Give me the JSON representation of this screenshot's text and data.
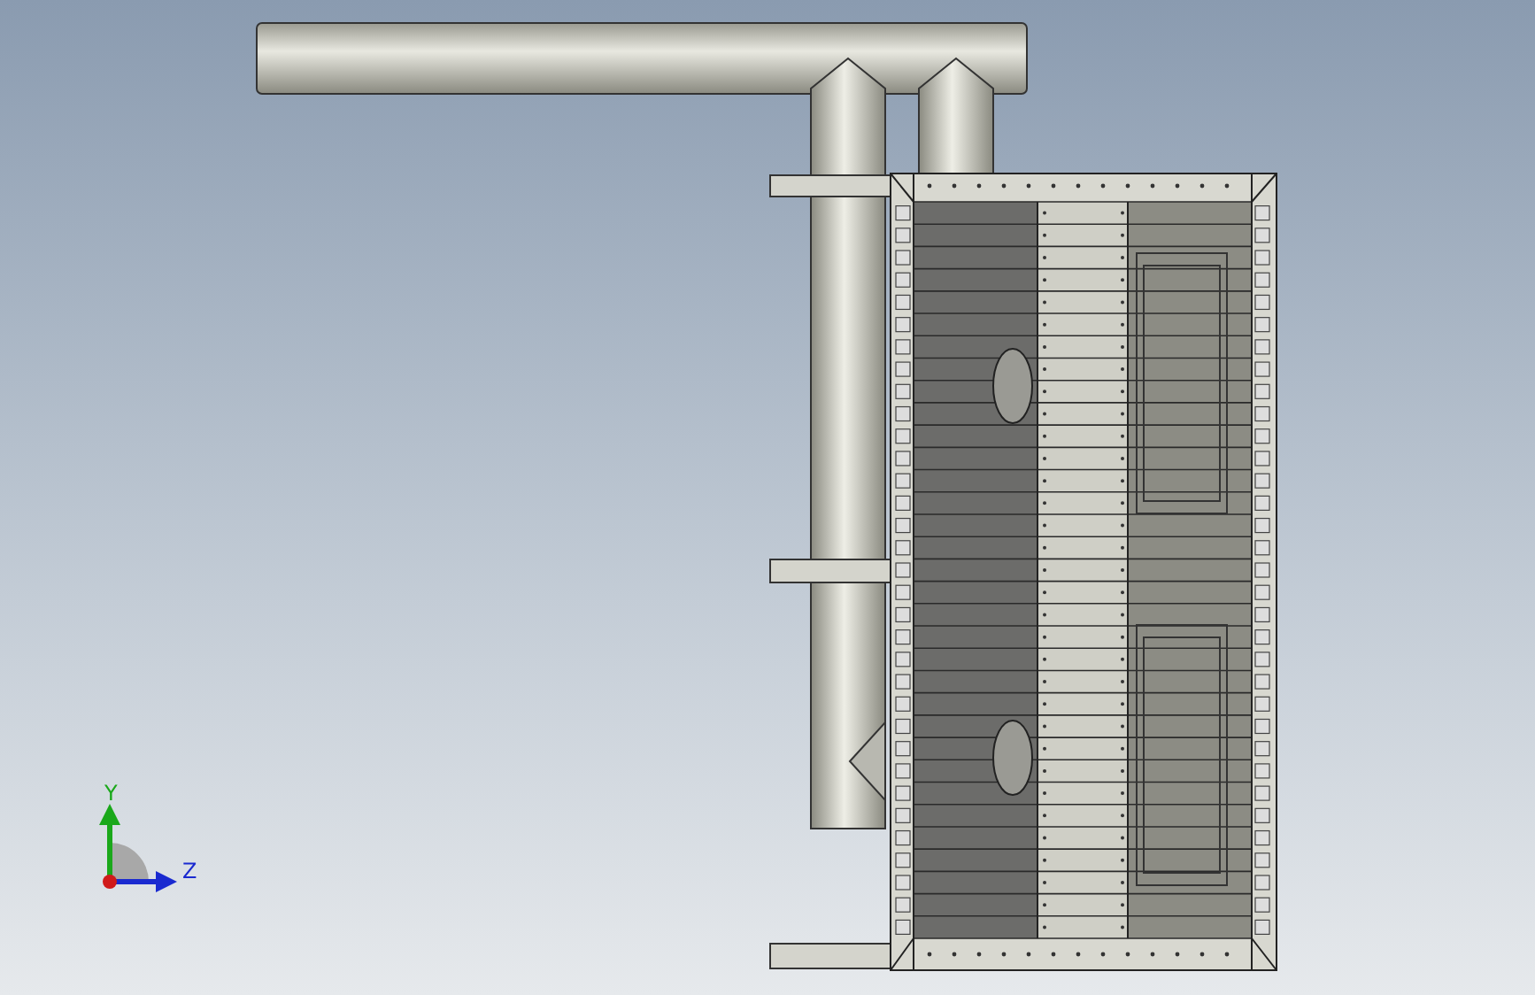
{
  "viewport": {
    "triad": {
      "y_label": "Y",
      "z_label": "Z"
    }
  }
}
